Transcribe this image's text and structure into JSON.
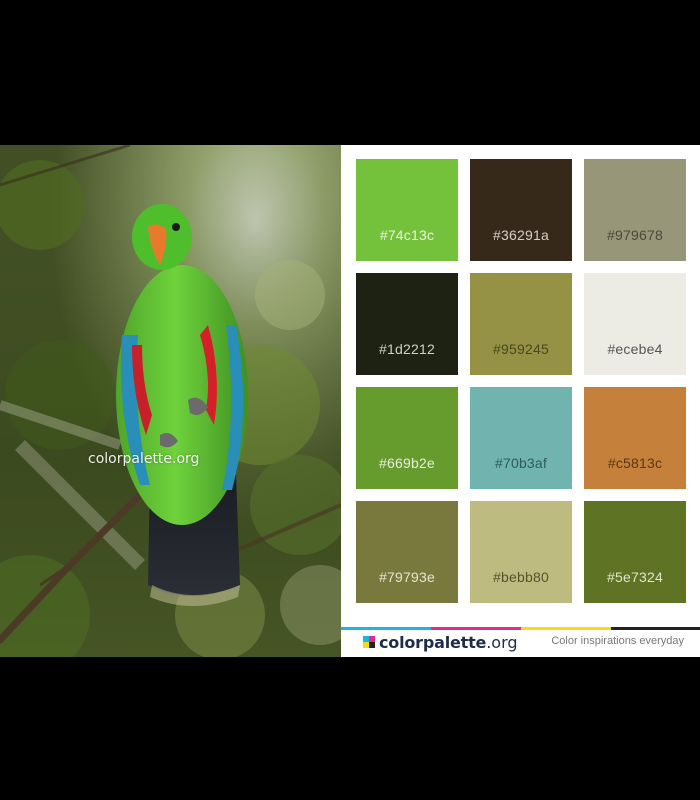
{
  "photo": {
    "watermark": "colorpalette.org"
  },
  "swatches": [
    {
      "hex": "#74c13c",
      "label": "#74c13c",
      "label_color": "#e9f5dd"
    },
    {
      "hex": "#36291a",
      "label": "#36291a",
      "label_color": "#d4cfc8"
    },
    {
      "hex": "#979678",
      "label": "#979678",
      "label_color": "#4b4a3a"
    },
    {
      "hex": "#1d2212",
      "label": "#1d2212",
      "label_color": "#cdd0c6"
    },
    {
      "hex": "#959245",
      "label": "#959245",
      "label_color": "#4a481f"
    },
    {
      "hex": "#ecebe4",
      "label": "#ecebe4",
      "label_color": "#555555"
    },
    {
      "hex": "#669b2e",
      "label": "#669b2e",
      "label_color": "#e5f0d8"
    },
    {
      "hex": "#70b3af",
      "label": "#70b3af",
      "label_color": "#2f5c59"
    },
    {
      "hex": "#c5813c",
      "label": "#c5813c",
      "label_color": "#5a3712"
    },
    {
      "hex": "#79793e",
      "label": "#79793e",
      "label_color": "#e6e6cf"
    },
    {
      "hex": "#bebb80",
      "label": "#bebb80",
      "label_color": "#55532e"
    },
    {
      "hex": "#5e7324",
      "label": "#5e7324",
      "label_color": "#dfe7c9"
    }
  ],
  "footer": {
    "brand_name": "colorpalette",
    "brand_tld": ".org",
    "tagline": "Color inspirations everyday",
    "stripe_colors": [
      "#1eb4e6",
      "#e6298a",
      "#f5dc14",
      "#222222"
    ],
    "logo_colors": [
      "#1eb4e6",
      "#e6298a",
      "#f5dc14",
      "#222222"
    ]
  }
}
